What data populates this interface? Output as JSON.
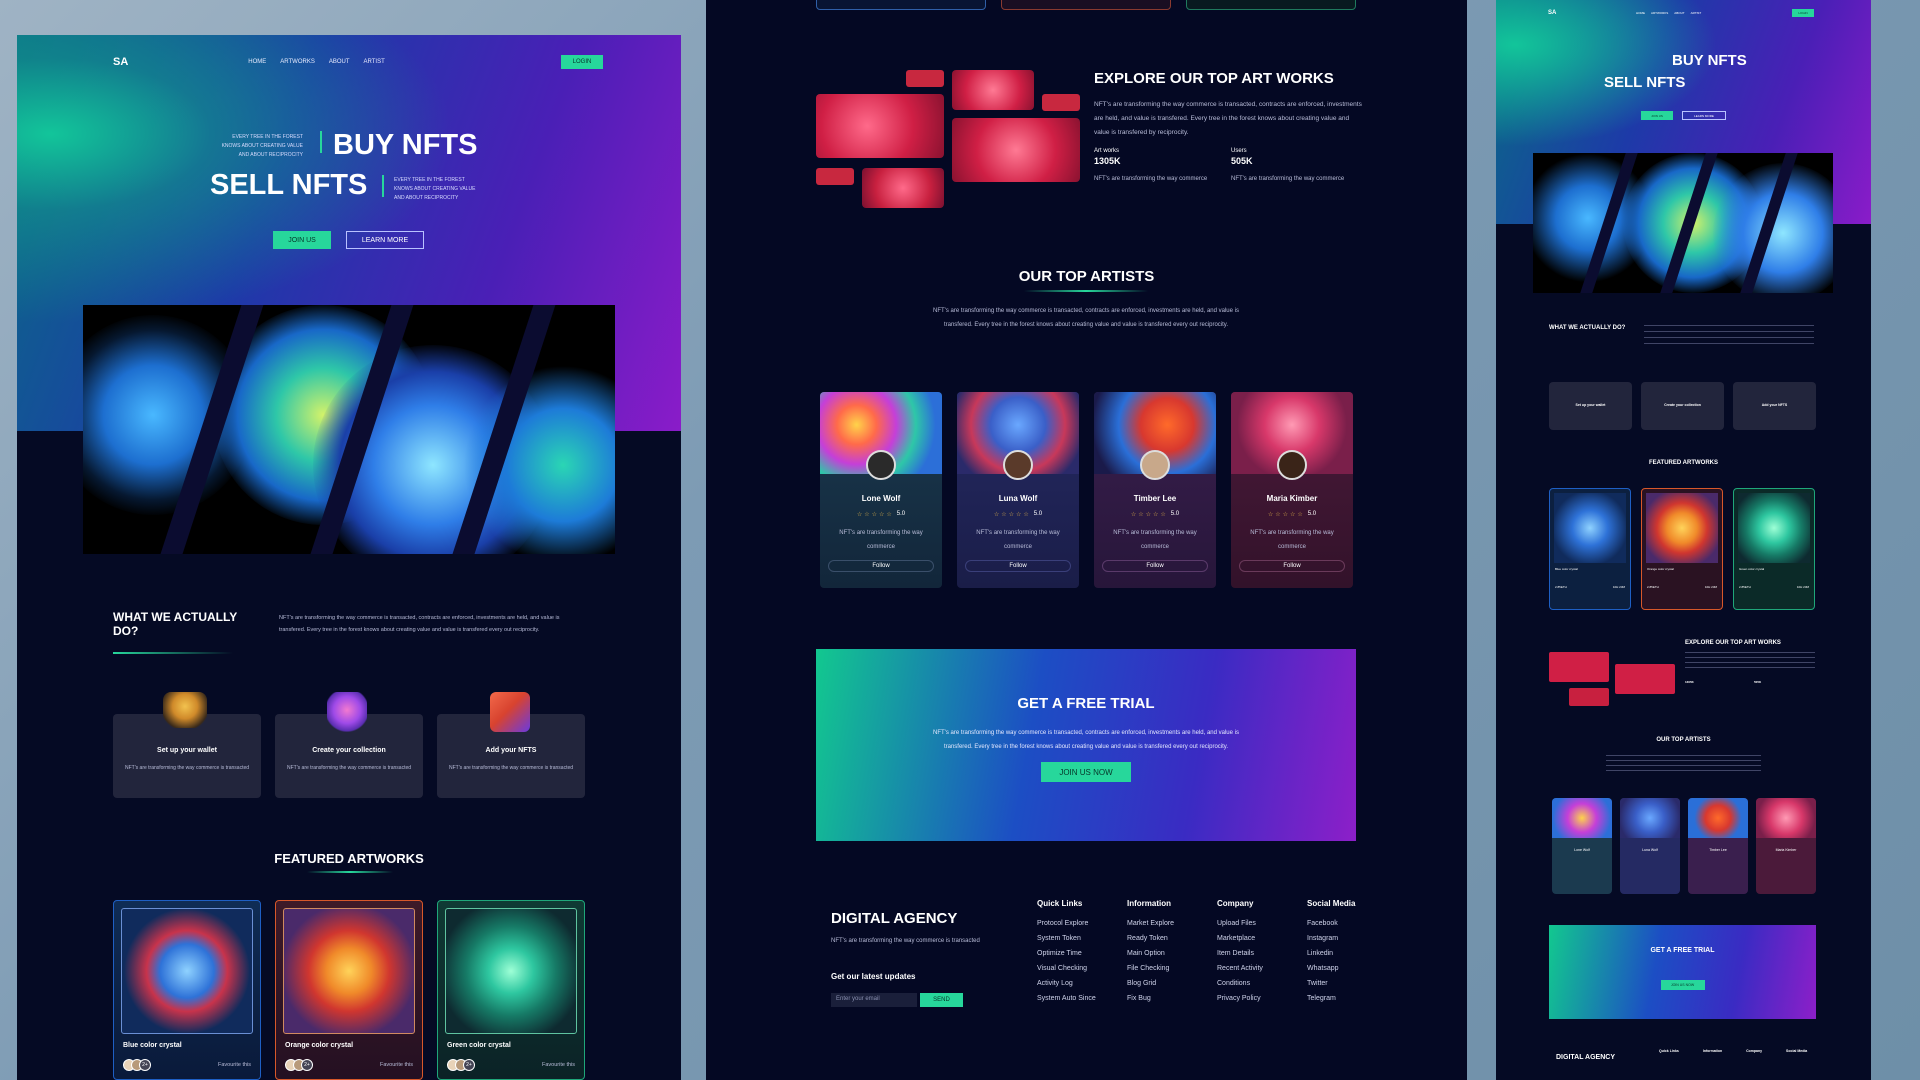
{
  "brand": {
    "logo": "SA",
    "accent": "#27d79b"
  },
  "nav": {
    "items": [
      "HOME",
      "ARTWORKS",
      "ABOUT",
      "ARTIST"
    ],
    "login": "LOGIN"
  },
  "hero": {
    "buy": "BUY NFTS",
    "sell": "SELL NFTS",
    "tagline": "EVERY TREE IN THE FOREST KNOWS ABOUT CREATING VALUE AND ABOUT RECIPROCITY",
    "join": "JOIN US",
    "learn": "LEARN MORE"
  },
  "what": {
    "title": "WHAT WE ACTUALLY DO?",
    "text": "NFT's are transforming the way commerce is transacted, contracts are enforced, investments are held, and value is transfered. Every tree in the forest knows about creating value and value is transfered every out reciprocity.",
    "steps": [
      {
        "title": "Set up your wallet",
        "icon": "wallet-icon",
        "text": "NFT's are transforming the way commerce is transacted"
      },
      {
        "title": "Create your collection",
        "icon": "camera-icon",
        "text": "NFT's are transforming the way commerce is transacted"
      },
      {
        "title": "Add your NFTS",
        "icon": "gift-icon",
        "text": "NFT's are transforming the way commerce is transacted"
      }
    ]
  },
  "featured": {
    "title": "FEATURED ARTWORKS",
    "items": [
      {
        "title": "Blue color crystal",
        "fav": "Favourite this",
        "count": "2+",
        "price": "2.85ETH",
        "bid": "10H 23M",
        "color": "#1e5fc4"
      },
      {
        "title": "Orange color crystal",
        "fav": "Favourite this",
        "count": "2+",
        "price": "2.85ETH",
        "bid": "10H 23M",
        "color": "#d8582a"
      },
      {
        "title": "Green color crystal",
        "fav": "Favourite this",
        "count": "2+",
        "price": "2.85ETH",
        "bid": "10H 23M",
        "color": "#1fa77a"
      }
    ]
  },
  "explore": {
    "title": "EXPLORE OUR TOP ART WORKS",
    "text": "NFT's are transforming the way commerce is transacted, contracts are enforced, investments are held, and value is transfered. Every tree in the forest knows about creating value and value is transfered by reciprocity.",
    "stats": [
      {
        "label": "Art works",
        "value": "1305K",
        "text": "NFT's are transforming the way commerce"
      },
      {
        "label": "Users",
        "value": "505K",
        "text": "NFT's are transforming the way commerce"
      }
    ]
  },
  "artists": {
    "title": "OUR TOP ARTISTS",
    "text": "NFT's are transforming the way commerce is transacted, contracts are enforced, investments are held, and value is transfered. Every tree in the forest knows about creating value and value is transfered every out reciprocity.",
    "items": [
      {
        "name": "Lone Wolf",
        "rating": "5.0",
        "text": "NFT's are transforming the way commerce",
        "follow": "Follow",
        "bg": "#1b3a4f"
      },
      {
        "name": "Luna Wolf",
        "rating": "5.0",
        "text": "NFT's are transforming the way commerce",
        "follow": "Follow",
        "bg": "#252a63"
      },
      {
        "name": "Timber Lee",
        "rating": "5.0",
        "text": "NFT's are transforming the way commerce",
        "follow": "Follow",
        "bg": "#3a1f4e"
      },
      {
        "name": "Maria Kimber",
        "rating": "5.0",
        "text": "NFT's are transforming the way commerce",
        "follow": "Follow",
        "bg": "#4b1a3a"
      }
    ]
  },
  "trial": {
    "title": "GET A FREE TRIAL",
    "text": "NFT's are transforming the way commerce is transacted, contracts are enforced, investments are held, and value is transfered. Every tree in the forest knows about creating value and value is transfered every out reciprocity.",
    "button": "JOIN US NOW"
  },
  "footer": {
    "brand": "DIGITAL AGENCY",
    "brand_text": "NFT's are transforming the way commerce is transacted",
    "updates": "Get our latest updates",
    "email_placeholder": "Enter your email",
    "send": "SEND",
    "cols": [
      {
        "title": "Quick Links",
        "links": [
          "Protocol Explore",
          "System Token",
          "Optimize Time",
          "Visual Checking",
          "Activity Log",
          "System Auto Since"
        ]
      },
      {
        "title": "Information",
        "links": [
          "Market Explore",
          "Ready Token",
          "Main Option",
          "File Checking",
          "Blog Grid",
          "Fix Bug"
        ]
      },
      {
        "title": "Company",
        "links": [
          "Upload Files",
          "Marketplace",
          "Item Details",
          "Recent Activity",
          "Conditions",
          "Privacy Policy"
        ]
      },
      {
        "title": "Social Media",
        "links": [
          "Facebook",
          "Instagram",
          "Linkedin",
          "Whatsapp",
          "Twitter",
          "Telegram"
        ]
      }
    ]
  }
}
